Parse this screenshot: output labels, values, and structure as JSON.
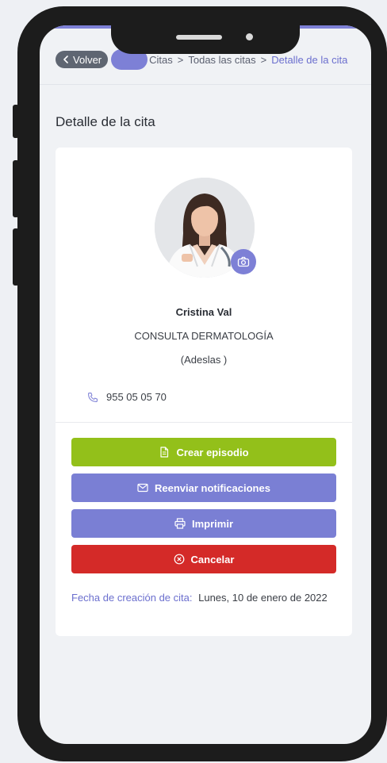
{
  "colors": {
    "accent": "#7d80d6",
    "green": "#93c01a",
    "purple": "#7a7fd4",
    "red": "#d42a28"
  },
  "nav": {
    "back_label": "Volver",
    "breadcrumbs": [
      "Citas",
      "Todas las citas",
      "Detalle de la cita"
    ],
    "separator": ">"
  },
  "page": {
    "title": "Detalle de la cita"
  },
  "contact": {
    "name": "Cristina Val",
    "specialty": "CONSULTA DERMATOLOGÍA",
    "insurance": "(Adeslas )",
    "phone": "955 05 05 70"
  },
  "actions": {
    "create_episode": "Crear episodio",
    "resend_notifications": "Reenviar notificaciones",
    "print": "Imprimir",
    "cancel": "Cancelar"
  },
  "created": {
    "label": "Fecha de creación de cita:",
    "value": "Lunes, 10 de enero de 2022"
  },
  "icons": [
    "chevron-left-icon",
    "camera-icon",
    "phone-icon",
    "document-icon",
    "envelope-icon",
    "printer-icon",
    "cancel-circle-icon"
  ]
}
